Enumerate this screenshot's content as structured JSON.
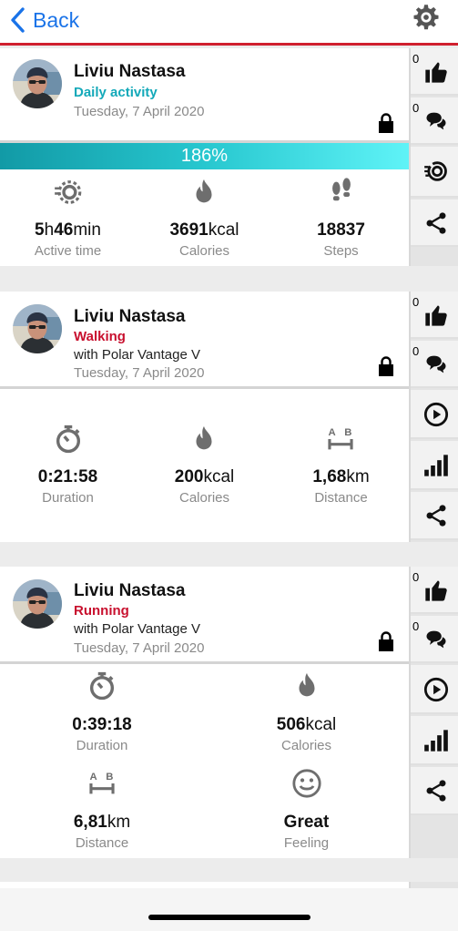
{
  "nav": {
    "back_label": "Back"
  },
  "cards": [
    {
      "name": "Liviu Nastasa",
      "activity": "Daily activity",
      "date": "Tuesday, 7 April 2020",
      "progress": "186%",
      "likes": "0",
      "comments": "0",
      "metrics": [
        {
          "val_a": "5",
          "unit_a": "h",
          "val_b": "46",
          "unit_b": "min",
          "label": "Active time"
        },
        {
          "val": "3691",
          "unit": "kcal",
          "label": "Calories"
        },
        {
          "val": "18837",
          "unit": "",
          "label": "Steps"
        }
      ]
    },
    {
      "name": "Liviu Nastasa",
      "activity": "Walking",
      "device": "with Polar Vantage V",
      "date": "Tuesday, 7 April 2020",
      "likes": "0",
      "comments": "0",
      "metrics": [
        {
          "val": "0:21:58",
          "unit": "",
          "label": "Duration"
        },
        {
          "val": "200",
          "unit": "kcal",
          "label": "Calories"
        },
        {
          "val": "1,68",
          "unit": "km",
          "label": "Distance"
        }
      ]
    },
    {
      "name": "Liviu Nastasa",
      "activity": "Running",
      "device": "with Polar Vantage V",
      "date": "Tuesday, 7 April 2020",
      "likes": "0",
      "comments": "0",
      "metrics": [
        {
          "val": "0:39:18",
          "unit": "",
          "label": "Duration"
        },
        {
          "val": "506",
          "unit": "kcal",
          "label": "Calories"
        },
        {
          "val": "6,81",
          "unit": "km",
          "label": "Distance"
        },
        {
          "val": "Great",
          "unit": "",
          "label": "Feeling"
        }
      ]
    }
  ]
}
